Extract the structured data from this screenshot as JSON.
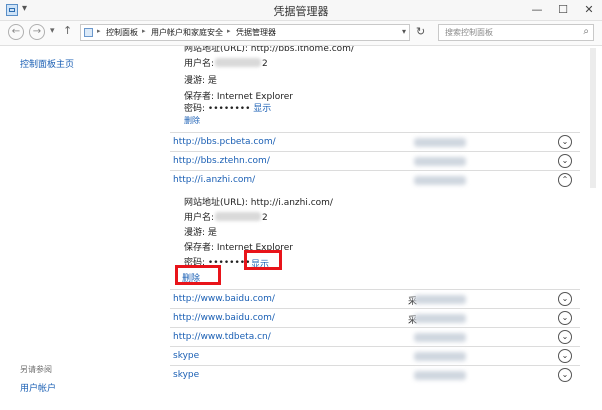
{
  "window": {
    "title": "凭据管理器",
    "minimize": "—",
    "maximize": "☐",
    "close": "✕"
  },
  "toolbar_glyphs": {
    "qat": "▾",
    "drop": "▾"
  },
  "address": {
    "back": "←",
    "forward": "→",
    "recent": "▾",
    "up": "↑",
    "crumbs": [
      "控制面板",
      "用户帐户和家庭安全",
      "凭据管理器"
    ],
    "separator": "▸",
    "dropdown": "▾",
    "refresh": "↻",
    "search_placeholder": "搜索控制面板",
    "search_icon": "⌕"
  },
  "left_pane": {
    "home_link": "控制面板主页",
    "see_also": "另请参阅",
    "accounts_link": "用户帐户"
  },
  "expanded_top": {
    "cut_line": "网站地址(URL): http://bbs.ithome.com/",
    "username_label": "用户名:",
    "username_suffix": "2",
    "roaming": "漫游: 是",
    "saved_by": "保存者: Internet Explorer",
    "password_label": "密码:",
    "password_mask": "••••••••",
    "show": "显示",
    "delete": "删除"
  },
  "entries": [
    {
      "url": "http://bbs.pcbeta.com/",
      "user": "",
      "chevron": "down"
    },
    {
      "url": "http://bbs.ztehn.com/",
      "user": "",
      "chevron": "down"
    },
    {
      "url": "http://i.anzhi.com/",
      "user": "",
      "chevron": "up"
    },
    {
      "url": "http://www.baidu.com/",
      "user": "采",
      "chevron": "down"
    },
    {
      "url": "http://www.baidu.com/",
      "user": "采",
      "chevron": "down"
    },
    {
      "url": "http://www.tdbeta.cn/",
      "user": "",
      "chevron": "down"
    },
    {
      "url": "skype",
      "user": "",
      "chevron": "down"
    },
    {
      "url": "skype",
      "user": "",
      "chevron": "down"
    }
  ],
  "chevron_glyphs": {
    "down": "⌄",
    "up": "⌃"
  },
  "expanded_anzhi": {
    "url_line": "网站地址(URL): http://i.anzhi.com/",
    "username_label": "用户名:",
    "username_suffix": "2",
    "roaming": "漫游: 是",
    "saved_by": "保存者: Internet Explorer",
    "password_label": "密码:",
    "password_mask": "••••••••",
    "show": "显示",
    "delete": "删除"
  },
  "colors": {
    "link": "#1a5fb4",
    "highlight": "#e8141a"
  }
}
